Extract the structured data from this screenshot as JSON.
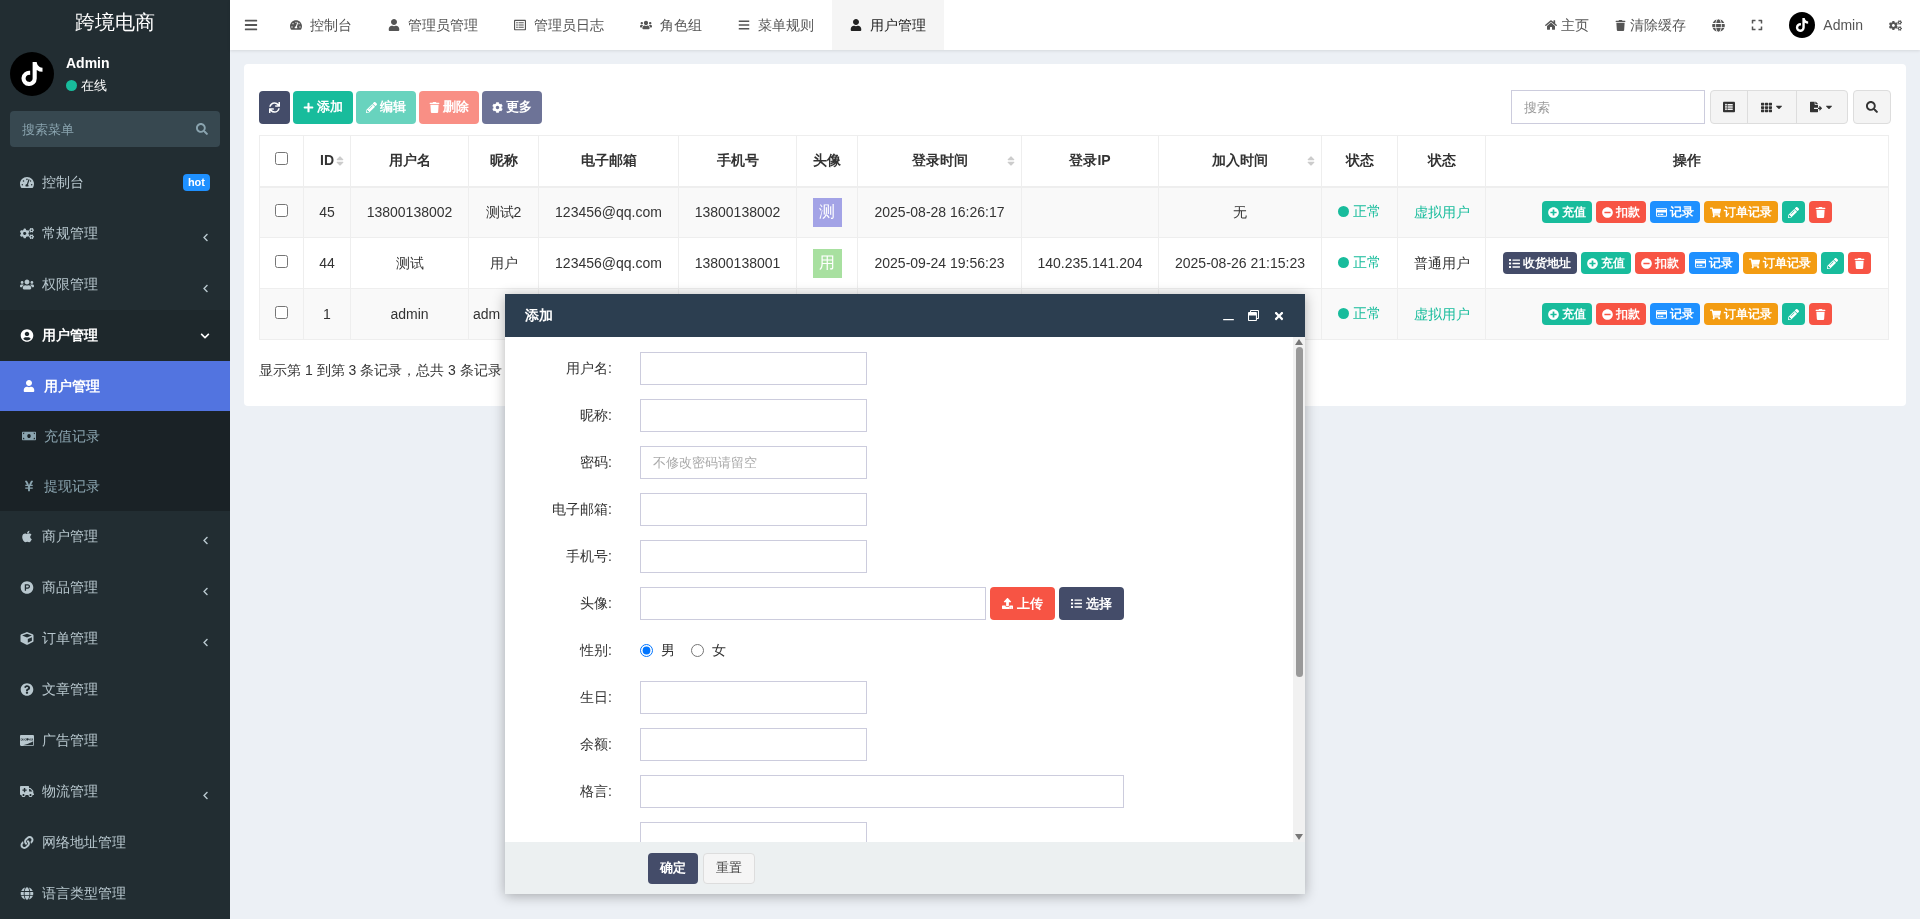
{
  "brand": "跨境电商",
  "user_panel": {
    "name": "Admin",
    "status": "在线"
  },
  "sidebar": {
    "search_placeholder": "搜索菜单",
    "items": [
      {
        "label": "控制台",
        "selected": false,
        "badge": "hot"
      },
      {
        "label": "常规管理",
        "selected": false,
        "expanded": false
      },
      {
        "label": "权限管理",
        "selected": false,
        "expanded": false
      },
      {
        "label": "用户管理",
        "selected": false,
        "expanded": true,
        "children": [
          {
            "label": "用户管理",
            "selected": true
          },
          {
            "label": "充值记录",
            "selected": false
          },
          {
            "label": "提现记录",
            "selected": false
          }
        ]
      },
      {
        "label": "商户管理",
        "selected": false,
        "expanded": false
      },
      {
        "label": "商品管理",
        "selected": false,
        "expanded": false
      },
      {
        "label": "订单管理",
        "selected": false,
        "expanded": false
      },
      {
        "label": "文章管理",
        "selected": false
      },
      {
        "label": "广告管理",
        "selected": false
      },
      {
        "label": "物流管理",
        "selected": false,
        "expanded": false
      },
      {
        "label": "网络地址管理",
        "selected": false
      },
      {
        "label": "语言类型管理",
        "selected": false
      }
    ]
  },
  "tabs": [
    {
      "label": "控制台",
      "selected": false
    },
    {
      "label": "管理员管理",
      "selected": false
    },
    {
      "label": "管理员日志",
      "selected": false
    },
    {
      "label": "角色组",
      "selected": false
    },
    {
      "label": "菜单规则",
      "selected": false
    },
    {
      "label": "用户管理",
      "selected": true
    }
  ],
  "top_right": {
    "home": "主页",
    "clear_cache": "清除缓存",
    "user": "Admin"
  },
  "toolbar": {
    "buttons": [
      {
        "kind": "refresh",
        "disabled": false
      },
      {
        "kind": "add",
        "label": "添加",
        "disabled": false
      },
      {
        "kind": "edit",
        "label": "编辑",
        "disabled": true
      },
      {
        "kind": "delete",
        "label": "删除",
        "disabled": true
      },
      {
        "kind": "more",
        "label": "更多",
        "disabled": false
      }
    ],
    "search_placeholder": "搜索"
  },
  "table": {
    "header_checked": false,
    "columns": [
      {
        "label": "ID",
        "sortable": true
      },
      {
        "label": "用户名",
        "sortable": false
      },
      {
        "label": "昵称",
        "sortable": false
      },
      {
        "label": "电子邮箱",
        "sortable": false
      },
      {
        "label": "手机号",
        "sortable": false
      },
      {
        "label": "头像",
        "sortable": false
      },
      {
        "label": "登录时间",
        "sortable": true
      },
      {
        "label": "登录IP",
        "sortable": false
      },
      {
        "label": "加入时间",
        "sortable": true
      },
      {
        "label": "状态",
        "sortable": false
      },
      {
        "label": "状态",
        "sortable": false
      },
      {
        "label": "操作",
        "sortable": false
      }
    ],
    "rows": [
      {
        "checked": false,
        "id": "45",
        "username": "13800138002",
        "nickname": "测试2",
        "email": "123456@qq.com",
        "phone": "13800138002",
        "avatar": {
          "text": "测",
          "color": "#a3a3e6"
        },
        "login_time": "2025-08-28 16:26:17",
        "join_time": "无",
        "status": "正常",
        "user_type": {
          "text": "虚拟用户",
          "color": "#18bc9c"
        },
        "actions": [
          {
            "kind": "recharge",
            "label": "充值"
          },
          {
            "kind": "deduct",
            "label": "扣款"
          },
          {
            "kind": "records",
            "label": "记录"
          },
          {
            "kind": "orders",
            "label": "订单记录"
          },
          {
            "kind": "edit"
          },
          {
            "kind": "delete"
          }
        ]
      },
      {
        "checked": false,
        "id": "44",
        "username": "测试",
        "nickname": "用户",
        "email": "123456@qq.com",
        "phone": "13800138001",
        "avatar": {
          "text": "用",
          "color": "#a8e0a0"
        },
        "login_time": "2025-09-24 19:56:23",
        "login_ip": "140.235.141.204",
        "join_time": "2025-08-26 21:15:23",
        "status": "正常",
        "user_type": {
          "text": "普通用户",
          "color": "#333333"
        },
        "actions": [
          {
            "kind": "address",
            "label": "收货地址"
          },
          {
            "kind": "recharge",
            "label": "充值"
          },
          {
            "kind": "deduct",
            "label": "扣款"
          },
          {
            "kind": "records",
            "label": "记录"
          },
          {
            "kind": "orders",
            "label": "订单记录"
          },
          {
            "kind": "edit"
          },
          {
            "kind": "delete"
          }
        ]
      },
      {
        "checked": false,
        "id": "1",
        "username": "admin",
        "nickname": "adm",
        "status": "正常",
        "user_type": {
          "text": "虚拟用户",
          "color": "#18bc9c"
        },
        "actions": [
          {
            "kind": "recharge",
            "label": "充值"
          },
          {
            "kind": "deduct",
            "label": "扣款"
          },
          {
            "kind": "records",
            "label": "记录"
          },
          {
            "kind": "orders",
            "label": "订单记录"
          },
          {
            "kind": "edit"
          },
          {
            "kind": "delete"
          }
        ]
      }
    ],
    "summary": "显示第 1 到第 3 条记录，总共 3 条记录"
  },
  "dialog": {
    "title": "添加",
    "fields": [
      {
        "kind": "text",
        "label": "用户名:"
      },
      {
        "kind": "text",
        "label": "昵称:"
      },
      {
        "kind": "text",
        "label": "密码:",
        "placeholder": "不修改密码请留空"
      },
      {
        "kind": "text",
        "label": "电子邮箱:"
      },
      {
        "kind": "text",
        "label": "手机号:"
      },
      {
        "kind": "upload",
        "label": "头像:",
        "upload": "上传",
        "choose": "选择"
      },
      {
        "kind": "radio",
        "label": "性别:",
        "options": [
          {
            "label": "男",
            "selected": true
          },
          {
            "label": "女",
            "selected": false
          }
        ]
      },
      {
        "kind": "text",
        "label": "生日:"
      },
      {
        "kind": "text",
        "label": "余额:"
      },
      {
        "kind": "wide",
        "label": "格言:"
      },
      {
        "kind": "text"
      }
    ],
    "buttons": [
      {
        "kind": "primary",
        "label": "确定"
      },
      {
        "kind": "default",
        "label": "重置"
      }
    ]
  }
}
